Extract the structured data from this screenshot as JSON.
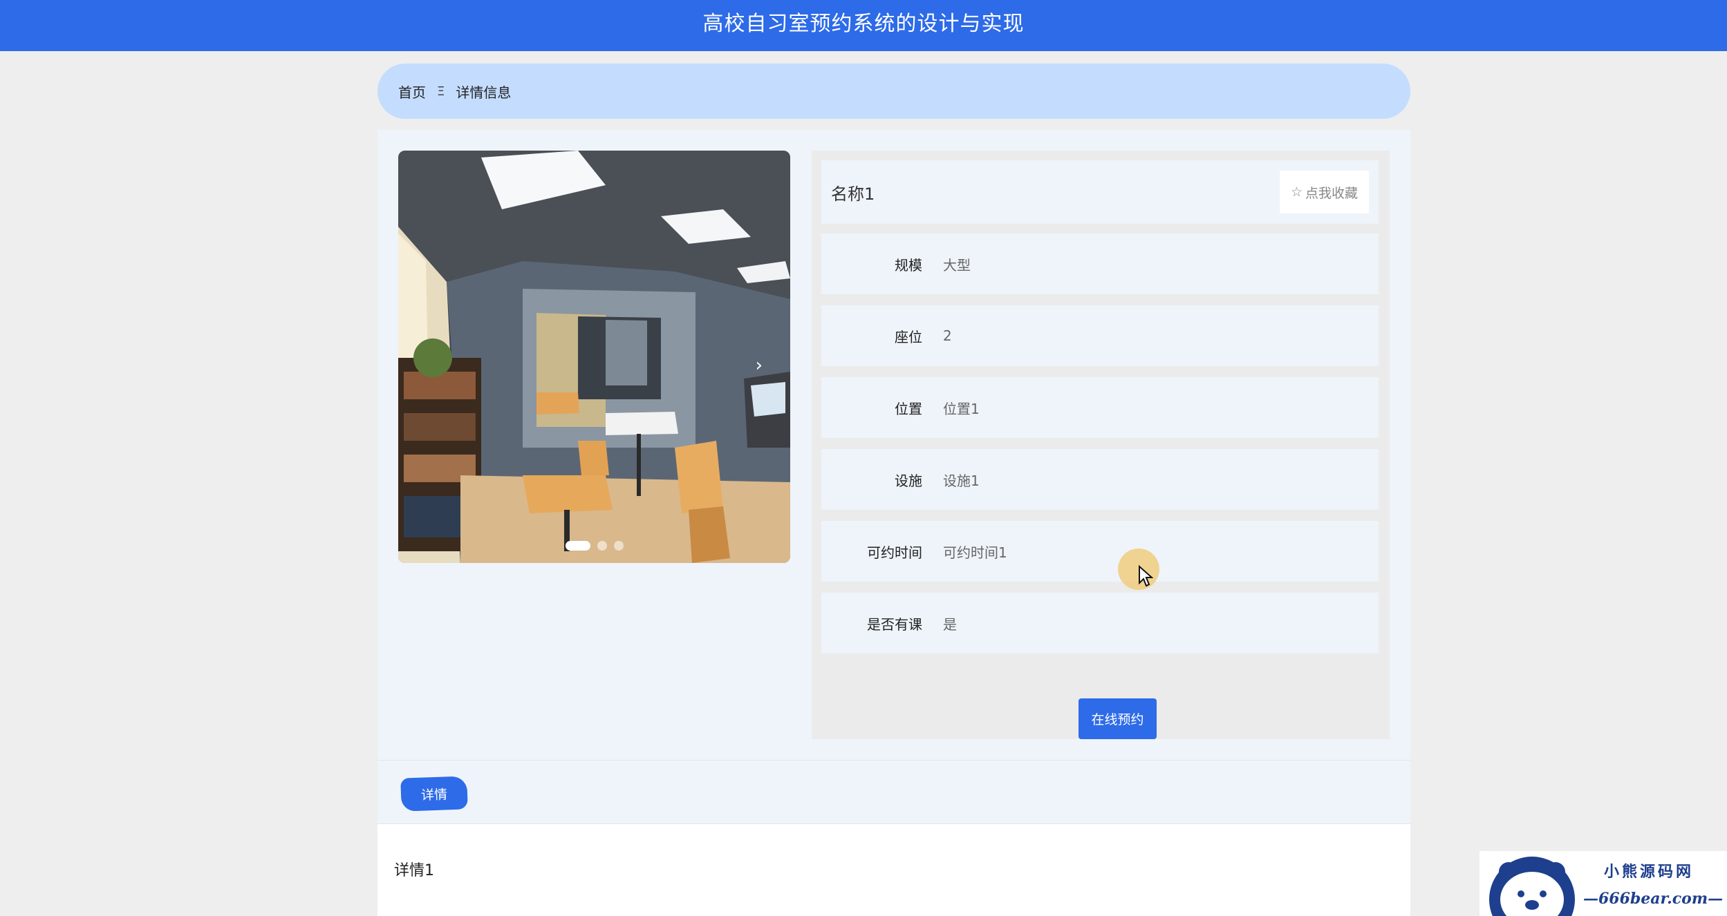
{
  "header": {
    "title": "高校自习室预约系统的设计与实现"
  },
  "breadcrumb": {
    "home": "首页",
    "separator": "Ξ",
    "current": "详情信息"
  },
  "carousel": {
    "next_icon": "chevron-right-icon",
    "slide_count": 3,
    "active_index": 0
  },
  "info": {
    "name": "名称1",
    "favorite_label": "点我收藏",
    "favorite_icon": "☆",
    "rows": [
      {
        "label": "规模",
        "value": "大型"
      },
      {
        "label": "座位",
        "value": "2"
      },
      {
        "label": "位置",
        "value": "位置1"
      },
      {
        "label": "设施",
        "value": "设施1"
      },
      {
        "label": "可约时间",
        "value": "可约时间1"
      },
      {
        "label": "是否有课",
        "value": "是"
      }
    ],
    "book_label": "在线预约"
  },
  "detail": {
    "tab_label": "详情",
    "content": "详情1"
  },
  "watermark": {
    "top": "小熊源码网",
    "bottom": "—666bear.com—"
  },
  "colors": {
    "primary": "#2d6be8",
    "breadcrumb_bg": "#c4dcfe",
    "panel_bg": "#eef4fa",
    "page_bg": "#eeeeee"
  }
}
